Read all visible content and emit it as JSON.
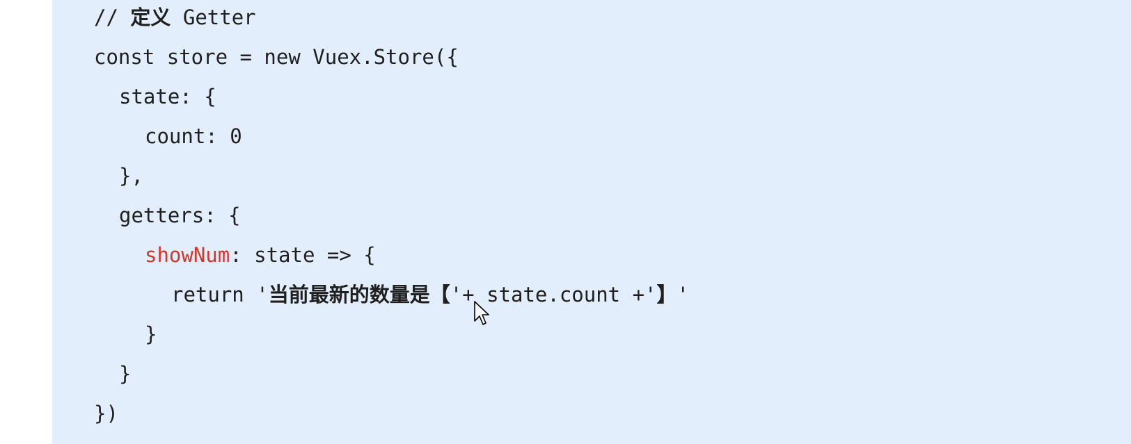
{
  "code": {
    "comment_prefix": "// ",
    "comment_text": "定义",
    "comment_rest": " Getter",
    "line2": "const store = new Vuex.Store({",
    "line3": "state: {",
    "line4": "count: 0",
    "line5": "},",
    "line6": "getters: {",
    "line7_key": "showNum",
    "line7_rest": ": state => {",
    "line8_prefix": "return '",
    "line8_cjk": "当前最新的数量是【",
    "line8_mid": "'+ state.count +'",
    "line8_close": "】",
    "line8_end": "'",
    "line9": "}",
    "line10": "}",
    "line11": "})"
  },
  "colors": {
    "panel_background": "#e2eefc",
    "code_text": "#1f1f1f",
    "property_key": "#d1362f"
  },
  "icons": {
    "cursor": "mouse-pointer-icon"
  }
}
